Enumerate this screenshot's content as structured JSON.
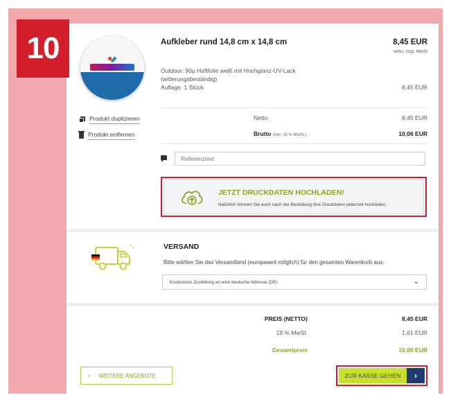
{
  "step_number": "10",
  "product": {
    "title": "Aufkleber rund 14,8 cm x 14,8 cm",
    "price": "8,45 EUR",
    "price_note": "netto, zzgl. MwSt",
    "description_line1": "Outdoor: 90µ Haftfolie weiß mit Hochglanz-UV-Lack",
    "description_line2": "(witterungsbeständig)",
    "description_line3": "Auflage: 1 Stück",
    "line_price": "8,45 EUR"
  },
  "actions": {
    "duplicate_label": "Produkt duplizieren",
    "remove_label": "Produkt entfernen"
  },
  "totals_item": {
    "netto_label": "Netto",
    "netto_value": "8,45 EUR",
    "brutto_label": "Brutto",
    "brutto_note": "(inkl. 19 % MwSt.)",
    "brutto_value": "10,06 EUR"
  },
  "reference": {
    "placeholder": "Referenztext"
  },
  "upload": {
    "title": "JETZT DRUCKDATEN HOCHLADEN!",
    "subtitle": "Natürlich können Sie auch nach der Bestellung Ihre Druckdaten jederzeit hochladen."
  },
  "shipping": {
    "title": "VERSAND",
    "text": "Bitte wählen Sie das Versandland (europaweit möglich) für den gesamten Warenkorb aus:",
    "selected_option": "Kostenlose Zustellung an eine deutsche Adresse (DE)"
  },
  "summary": {
    "net_label": "PREIS (NETTO)",
    "net_value": "8,45 EUR",
    "vat_label": "19 % MwSt.",
    "vat_value": "1,61 EUR",
    "total_label": "Gesamtpreis",
    "total_value": "10,06 EUR"
  },
  "buttons": {
    "more_offers": "WEITERE ANGEBOTE",
    "checkout": "ZUR KASSE GEHEN"
  },
  "colors": {
    "accent_green": "#8ba61f",
    "highlight_red": "#c62130",
    "checkout_yellow": "#c8e02c",
    "checkout_navy": "#1e3a6e",
    "badge_red": "#d21f2b",
    "frame_pink": "#f2a9ae"
  }
}
